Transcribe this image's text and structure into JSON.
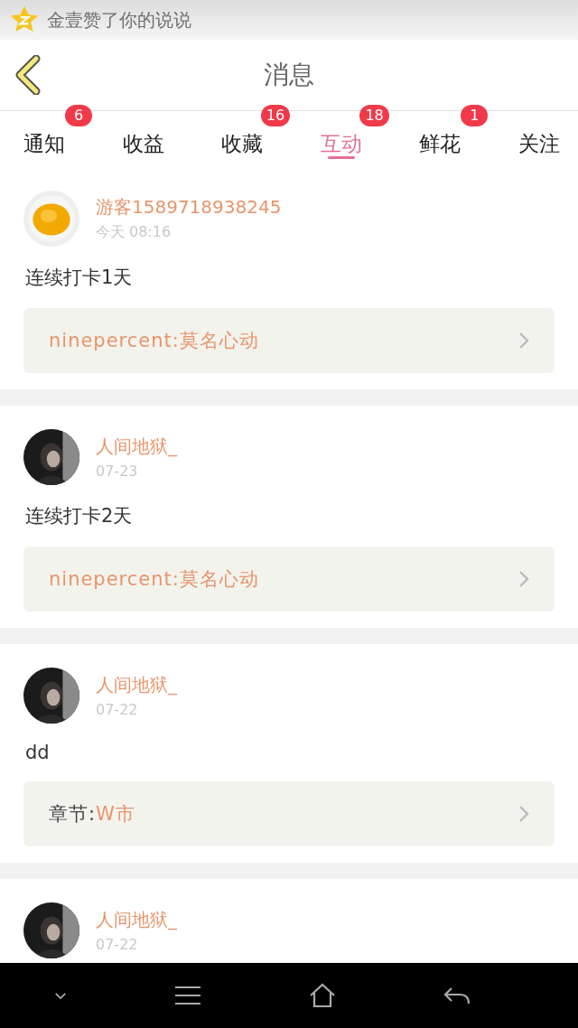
{
  "status_bar": {
    "notification": "金壹赞了你的说说"
  },
  "header": {
    "title": "消息"
  },
  "tabs": [
    {
      "label": "通知",
      "badge": "6",
      "selected": false
    },
    {
      "label": "收益",
      "selected": false
    },
    {
      "label": "收藏",
      "badge": "16",
      "selected": false
    },
    {
      "label": "互动",
      "badge": "18",
      "selected": true
    },
    {
      "label": "鲜花",
      "badge": "1",
      "selected": false
    },
    {
      "label": "关注",
      "selected": false
    }
  ],
  "messages": [
    {
      "name": "游客1589718938245",
      "time": "今天 08:16",
      "text": "连续打卡1天",
      "link": {
        "text": "ninepercent:莫名心动"
      }
    },
    {
      "name": "人间地狱_",
      "time": "07-23",
      "text": "连续打卡2天",
      "link": {
        "text": "ninepercent:莫名心动"
      }
    },
    {
      "name": "人间地狱_",
      "time": "07-22",
      "text": "dd",
      "link": {
        "prefix": "章节:",
        "text": "W市"
      }
    },
    {
      "name": "人间地狱_",
      "time": "07-22"
    }
  ]
}
